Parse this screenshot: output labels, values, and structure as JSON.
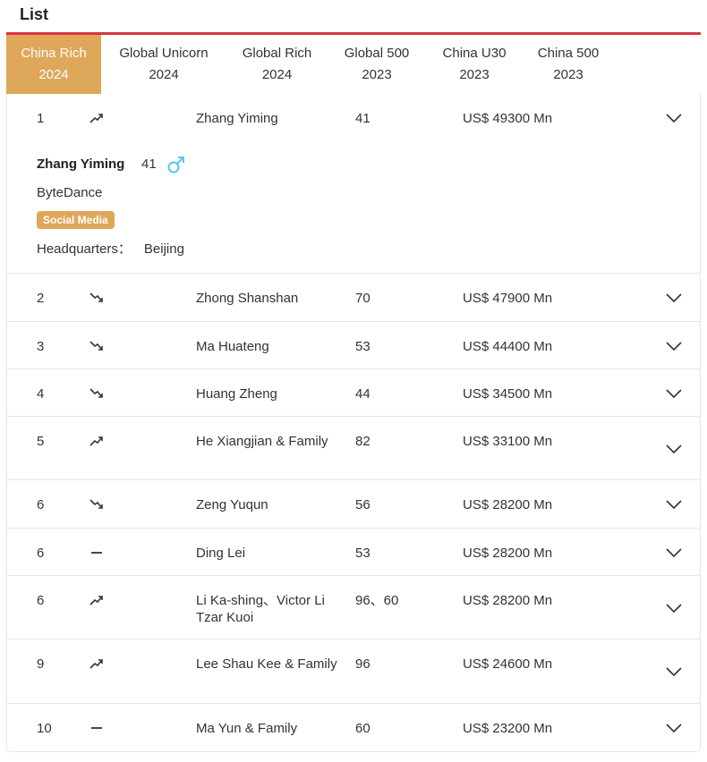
{
  "header": {
    "title": "List"
  },
  "tabs": [
    {
      "line1": "China Rich",
      "line2": "2024",
      "active": true
    },
    {
      "line1": "Global Unicorn",
      "line2": "2024",
      "active": false
    },
    {
      "line1": "Global Rich",
      "line2": "2024",
      "active": false
    },
    {
      "line1": "Global 500",
      "line2": "2023",
      "active": false
    },
    {
      "line1": "China U30",
      "line2": "2023",
      "active": false
    },
    {
      "line1": "China 500",
      "line2": "2023",
      "active": false
    }
  ],
  "colors": {
    "accent": "#dea75a",
    "topline": "#d9343f",
    "male_icon": "#5bc6e8"
  },
  "rows": [
    {
      "rank": "1",
      "trend": "up",
      "name": "Zhang Yiming",
      "age": "41",
      "worth": "US$ 49300 Mn",
      "expanded": true
    },
    {
      "rank": "2",
      "trend": "down",
      "name": "Zhong Shanshan",
      "age": "70",
      "worth": "US$ 47900 Mn"
    },
    {
      "rank": "3",
      "trend": "down",
      "name": "Ma Huateng",
      "age": "53",
      "worth": "US$ 44400 Mn"
    },
    {
      "rank": "4",
      "trend": "down",
      "name": "Huang Zheng",
      "age": "44",
      "worth": "US$ 34500 Mn"
    },
    {
      "rank": "5",
      "trend": "up",
      "name": "He Xiangjian & Family",
      "age": "82",
      "worth": "US$ 33100 Mn"
    },
    {
      "rank": "6",
      "trend": "down",
      "name": "Zeng Yuqun",
      "age": "56",
      "worth": "US$ 28200 Mn"
    },
    {
      "rank": "6",
      "trend": "flat",
      "name": "Ding Lei",
      "age": "53",
      "worth": "US$ 28200 Mn"
    },
    {
      "rank": "6",
      "trend": "up",
      "name": "Li Ka-shing、Victor Li Tzar Kuoi",
      "age": "96、60",
      "worth": "US$ 28200 Mn"
    },
    {
      "rank": "9",
      "trend": "up",
      "name": "Lee Shau Kee & Family",
      "age": "96",
      "worth": "US$ 24600 Mn"
    },
    {
      "rank": "10",
      "trend": "flat",
      "name": "Ma Yun & Family",
      "age": "60",
      "worth": "US$ 23200 Mn"
    }
  ],
  "detail": {
    "name": "Zhang Yiming",
    "age": "41",
    "gender_icon": "male-icon",
    "company": "ByteDance",
    "industry": "Social Media",
    "hq_label": "Headquarters：",
    "hq_value": "Beijing"
  }
}
